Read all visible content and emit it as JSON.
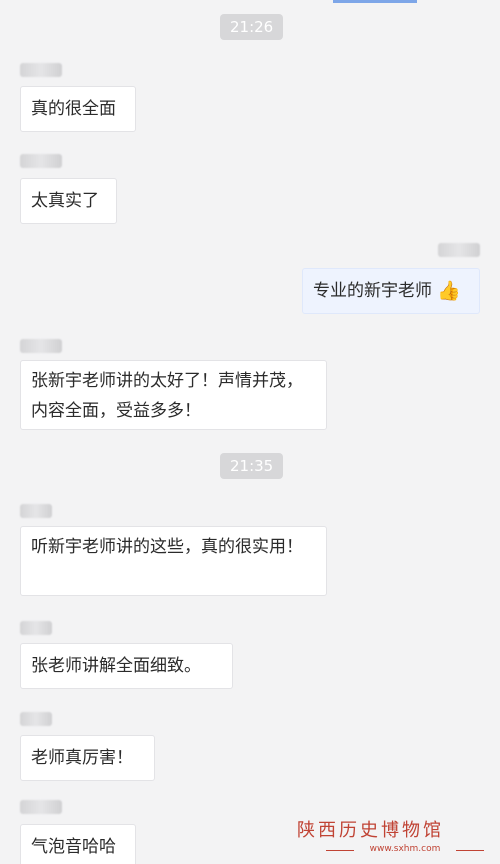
{
  "chat": {
    "timestamps": [
      "21:26",
      "21:35"
    ],
    "messages": [
      "真的很全面",
      "太真实了",
      "专业的新宇老师",
      "张新宇老师讲的太好了！声情并茂，内容全面，受益多多！",
      "听新宇老师讲的这些，真的很实用！",
      "张老师讲解全面细致。",
      "老师真厉害！",
      "气泡音哈哈"
    ],
    "self_emoji": "👍"
  },
  "watermark": {
    "title": "陕西历史博物馆",
    "url": "www.sxhm.com"
  },
  "colors": {
    "background": "#f3f3f4",
    "bubble": "#ffffff",
    "self_bubble": "#eef3fe",
    "watermark": "#c04334"
  }
}
